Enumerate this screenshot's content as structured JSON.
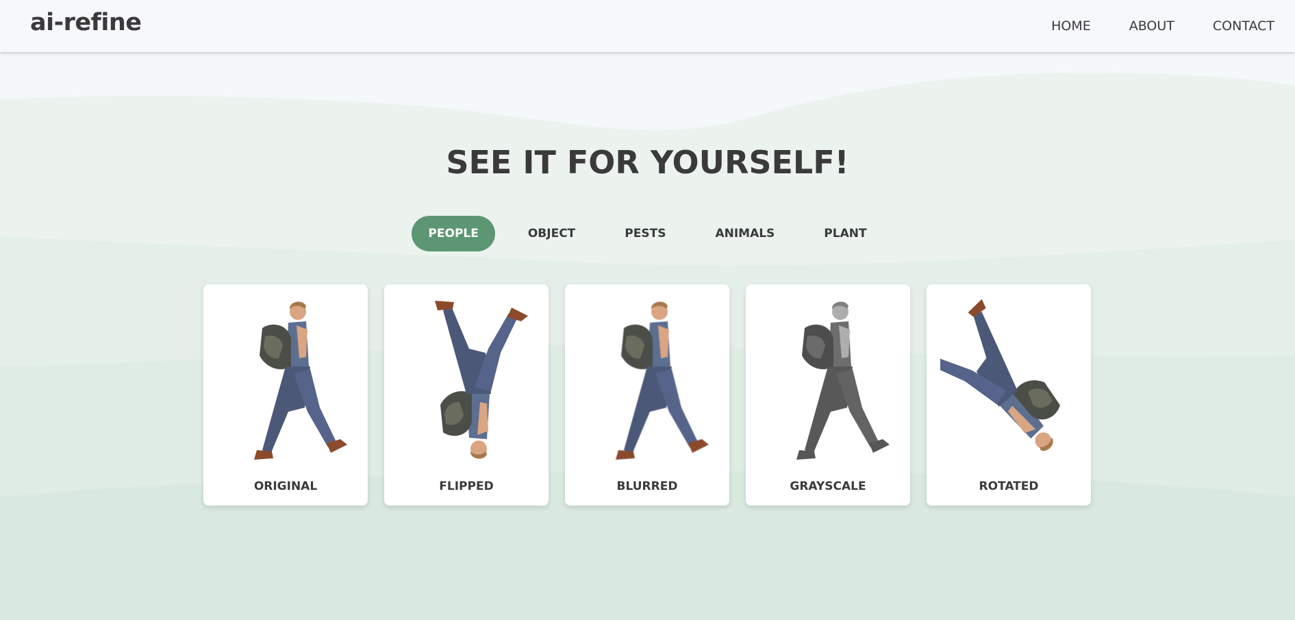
{
  "header": {
    "logo": "ai-refine",
    "nav": [
      "HOME",
      "ABOUT",
      "CONTACT"
    ]
  },
  "main": {
    "title": "SEE IT FOR YOURSELF!",
    "tabs": [
      {
        "label": "PEOPLE",
        "active": true
      },
      {
        "label": "OBJECT",
        "active": false
      },
      {
        "label": "PESTS",
        "active": false
      },
      {
        "label": "ANIMALS",
        "active": false
      },
      {
        "label": "PLANT",
        "active": false
      }
    ],
    "cards": [
      {
        "label": "ORIGINAL",
        "effect": "none"
      },
      {
        "label": "FLIPPED",
        "effect": "flip-vertical"
      },
      {
        "label": "BLURRED",
        "effect": "blur"
      },
      {
        "label": "GRAYSCALE",
        "effect": "grayscale"
      },
      {
        "label": "ROTATED",
        "effect": "rotate"
      }
    ]
  },
  "colors": {
    "accent": "#5c9672",
    "text": "#3a3a3a",
    "header_bg": "#f6f8fc"
  }
}
